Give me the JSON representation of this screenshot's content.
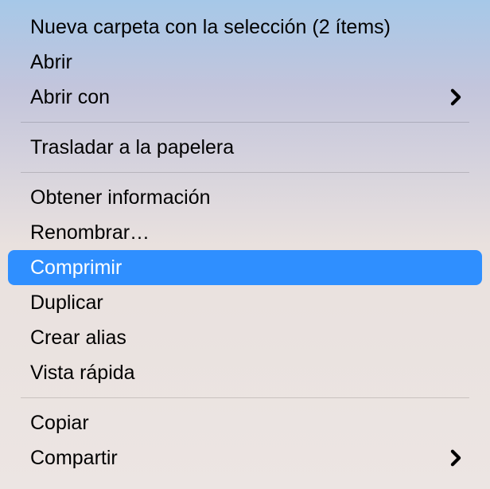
{
  "menu": {
    "items": [
      {
        "label": "Nueva carpeta con la selección (2 ítems)",
        "has_submenu": false
      },
      {
        "label": "Abrir",
        "has_submenu": false
      },
      {
        "label": "Abrir con",
        "has_submenu": true
      },
      {
        "separator": true
      },
      {
        "label": "Trasladar a la papelera",
        "has_submenu": false
      },
      {
        "separator": true
      },
      {
        "label": "Obtener información",
        "has_submenu": false
      },
      {
        "label": "Renombrar…",
        "has_submenu": false
      },
      {
        "label": "Comprimir",
        "has_submenu": false,
        "highlighted": true
      },
      {
        "label": "Duplicar",
        "has_submenu": false
      },
      {
        "label": "Crear alias",
        "has_submenu": false
      },
      {
        "label": "Vista rápida",
        "has_submenu": false
      },
      {
        "separator": true
      },
      {
        "label": "Copiar",
        "has_submenu": false
      },
      {
        "label": "Compartir",
        "has_submenu": true
      }
    ]
  }
}
